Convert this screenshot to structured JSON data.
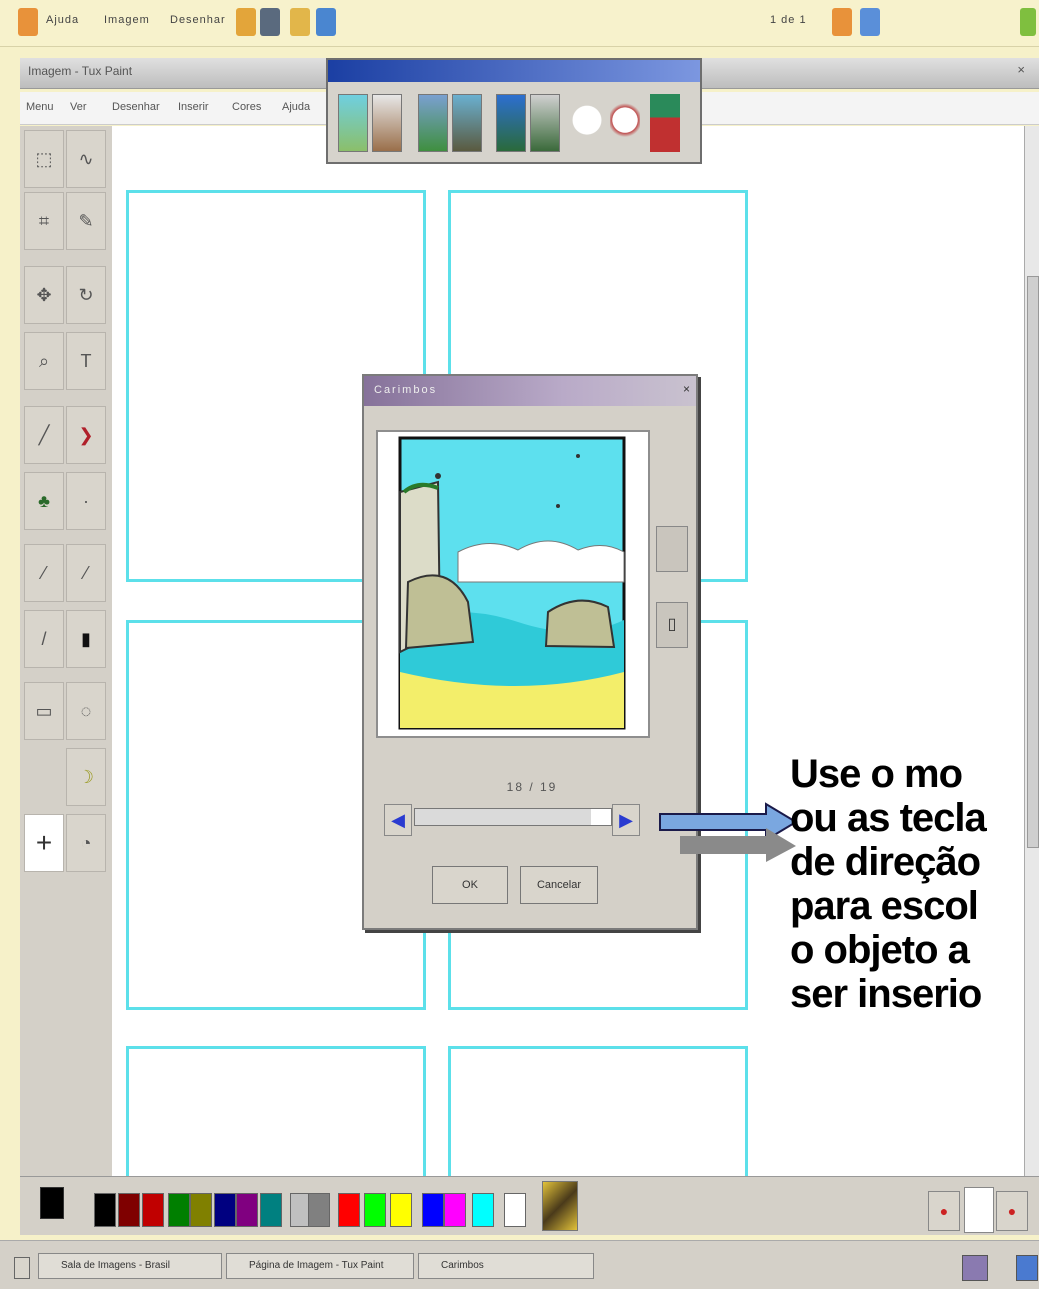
{
  "topbar": {
    "labels": [
      "Ajuda",
      "Imagem",
      "Desenhar"
    ],
    "right_label": "1 de 1"
  },
  "window": {
    "title": "Imagem - Tux Paint",
    "close": "×"
  },
  "menubar": {
    "items": [
      "Menu",
      "Ver",
      "Desenhar",
      "Inserir",
      "Cores",
      "Ajuda"
    ]
  },
  "stamp_palette": {
    "title": ""
  },
  "dialog": {
    "tab_label": "Carimbos",
    "close": "×",
    "counter": "18 / 19",
    "slider_value": 0.9,
    "left_arrow": "◀",
    "right_arrow": "▶",
    "ok_label": "OK",
    "cancel_label": "Cancelar"
  },
  "caption": {
    "lines": [
      "Use  o mo",
      "ou as tecla",
      "de direção",
      "para escol",
      "o objeto a",
      "ser inserio"
    ]
  },
  "palette": {
    "colors": [
      "#000000",
      "#7f0000",
      "#c00000",
      "#007f00",
      "#808000",
      "#000080",
      "#800080",
      "#008080",
      "#c0c0c0",
      "#808080",
      "#ff0000",
      "#00ff00",
      "#ffff00",
      "#0000ff",
      "#ff00ff",
      "#00ffff",
      "#ffffff"
    ]
  },
  "taskbar": {
    "items": [
      "Sala de Imagens - Brasil",
      "Página de Imagem - Tux Paint",
      "Carimbos"
    ]
  }
}
